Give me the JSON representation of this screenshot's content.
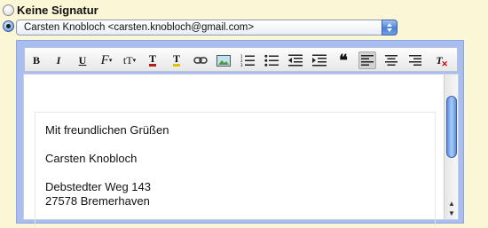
{
  "signature_options": {
    "none_label": "Keine Signatur",
    "selected_identity": "Carsten Knobloch <carsten.knobloch@gmail.com>"
  },
  "toolbar": {
    "buttons": [
      {
        "name": "bold-button",
        "icon": "bold-icon",
        "label": "B"
      },
      {
        "name": "italic-button",
        "icon": "italic-icon",
        "label": "I"
      },
      {
        "name": "underline-button",
        "icon": "underline-icon",
        "label": "U"
      },
      {
        "name": "font-family-button",
        "icon": "font-family-icon",
        "label": "F"
      },
      {
        "name": "font-size-button",
        "icon": "font-size-icon",
        "label": "tT"
      },
      {
        "name": "text-color-button",
        "icon": "text-color-icon",
        "label": "T"
      },
      {
        "name": "highlight-button",
        "icon": "highlight-icon",
        "label": "T"
      },
      {
        "name": "link-button",
        "icon": "link-icon"
      },
      {
        "name": "image-button",
        "icon": "image-icon"
      },
      {
        "name": "numbered-list-button",
        "icon": "numbered-list-icon"
      },
      {
        "name": "bullet-list-button",
        "icon": "bullet-list-icon"
      },
      {
        "name": "outdent-button",
        "icon": "outdent-icon"
      },
      {
        "name": "indent-button",
        "icon": "indent-icon"
      },
      {
        "name": "quote-button",
        "icon": "quote-icon",
        "label": "❝"
      },
      {
        "name": "align-left-button",
        "icon": "align-left-icon"
      },
      {
        "name": "align-center-button",
        "icon": "align-center-icon"
      },
      {
        "name": "align-right-button",
        "icon": "align-right-icon"
      },
      {
        "name": "remove-format-button",
        "icon": "remove-format-icon",
        "label": "T"
      }
    ]
  },
  "signature_text": {
    "line1": "Mit freundlichen Grüßen",
    "line2": "Carsten Knobloch",
    "line3": "Debstedter Weg 143",
    "line4": "27578 Bremerhaven"
  },
  "colors": {
    "page_bg": "#fbf6d6",
    "frame_bg": "#a9bef0",
    "accent_blue": "#4b80d6"
  }
}
